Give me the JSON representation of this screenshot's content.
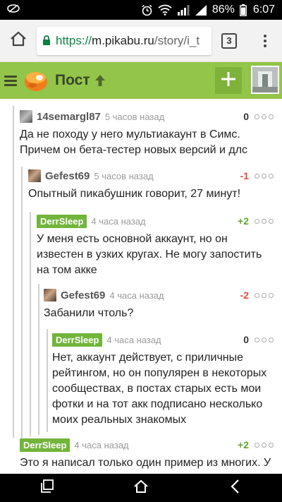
{
  "status_bar": {
    "battery": "86%",
    "time": "6:07"
  },
  "browser": {
    "url_scheme": "https://",
    "url_host": "m.pikabu.ru",
    "url_path": "/story/i_t",
    "tab_count": "3"
  },
  "header": {
    "title": "Пост"
  },
  "comments": [
    {
      "author": "14semargl87",
      "time": "5 часов назад",
      "rating": "0",
      "text": "Да не походу у него мультиакаунт в Симс. Причем он бета-тестер новых версий и длс"
    },
    {
      "author": "Gefest69",
      "time": "5 часов назад",
      "rating": "-1",
      "text": "Опытный пикабушник говорит, 27 минут!"
    },
    {
      "author": "DerrSleep",
      "time": "4 часа назад",
      "rating": "+2",
      "text": "У меня есть основной аккаунт, но он известен в узких кругах. Не могу запостить на том акке"
    },
    {
      "author": "Gefest69",
      "time": "4 часа назад",
      "rating": "-2",
      "text": "Забанили чтоль?"
    },
    {
      "author": "DerrSleep",
      "time": "4 часа назад",
      "rating": "0",
      "text": "Нет, аккаунт действует, с приличные рейтингом, но он популярен в некоторых сообществах, в постах старых есть мои фотки и на тот акк подписано несколько моих реальных знакомых"
    },
    {
      "author": "DerrSleep",
      "time": "4 часа назад",
      "rating": "+2",
      "text": "Это я написал только один пример из многих. У"
    }
  ]
}
